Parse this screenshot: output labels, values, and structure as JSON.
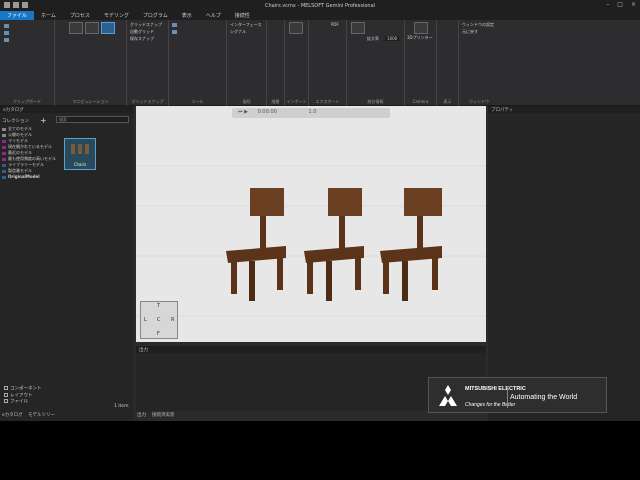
{
  "window": {
    "title": "Chairs.vcmx - MELSOFT Gemini Professional"
  },
  "menu": [
    "ファイル",
    "ホーム",
    "プロセス",
    "モデリング",
    "プログラム",
    "表示",
    "ヘルプ",
    "接続性"
  ],
  "ribbon": {
    "groups": [
      {
        "label": "クリップボード"
      },
      {
        "label": "マニピュレーション"
      },
      {
        "label": "グリッドスナップ"
      },
      {
        "label": "ツール"
      },
      {
        "label": "接続"
      },
      {
        "label": "階層"
      },
      {
        "label": "インポート"
      },
      {
        "label": "エクスポート"
      },
      {
        "label": "統計情報"
      },
      {
        "label": "Camera"
      },
      {
        "label": "表示"
      },
      {
        "label": "ウィンドウ"
      }
    ],
    "items": {
      "snap": "グリッドスナップ",
      "checkbox1": "自動グリッド",
      "checkbox2": "保存スナップ",
      "interface": "インターフェース",
      "signal": "シグナル",
      "pdf": "PDF",
      "zoom": "拡大率",
      "zoom_value": "1000",
      "camera_btn": "3Dプリンター",
      "window_btn": "ウィンドウの設定",
      "restore": "元に戻す"
    }
  },
  "left_panel": {
    "title": "eカタログ",
    "search_placeholder": "検索",
    "collection_label": "コレクション",
    "tree": [
      "全てのモデル",
      "公開のモデル",
      "マイモデル",
      "現在開かれているモデル",
      "最近のモデル",
      "最も使用頻度の高いモデル",
      "ライブラリーモデル",
      "製造業モデル",
      "OriginalModel"
    ],
    "thumb_label": "Chairs",
    "checks": [
      "コンポーネント",
      "レイアウト",
      "ファイル"
    ],
    "item_count": "1 item",
    "tabs": [
      "eカタログ",
      "モデルツリー"
    ]
  },
  "viewport": {
    "time": "0:00:00",
    "speed": "1.0"
  },
  "navcube": {
    "L": "L",
    "T": "T",
    "R": "R",
    "F": "F",
    "C": "C"
  },
  "output": {
    "title": "出力",
    "tabs": [
      "出力",
      "接続済実装"
    ]
  },
  "properties": {
    "title": "プロパティ"
  },
  "banner": {
    "brand": "MITSUBISHI ELECTRIC",
    "tagline": "Changes for the Better",
    "slogan": "Automating the World"
  }
}
